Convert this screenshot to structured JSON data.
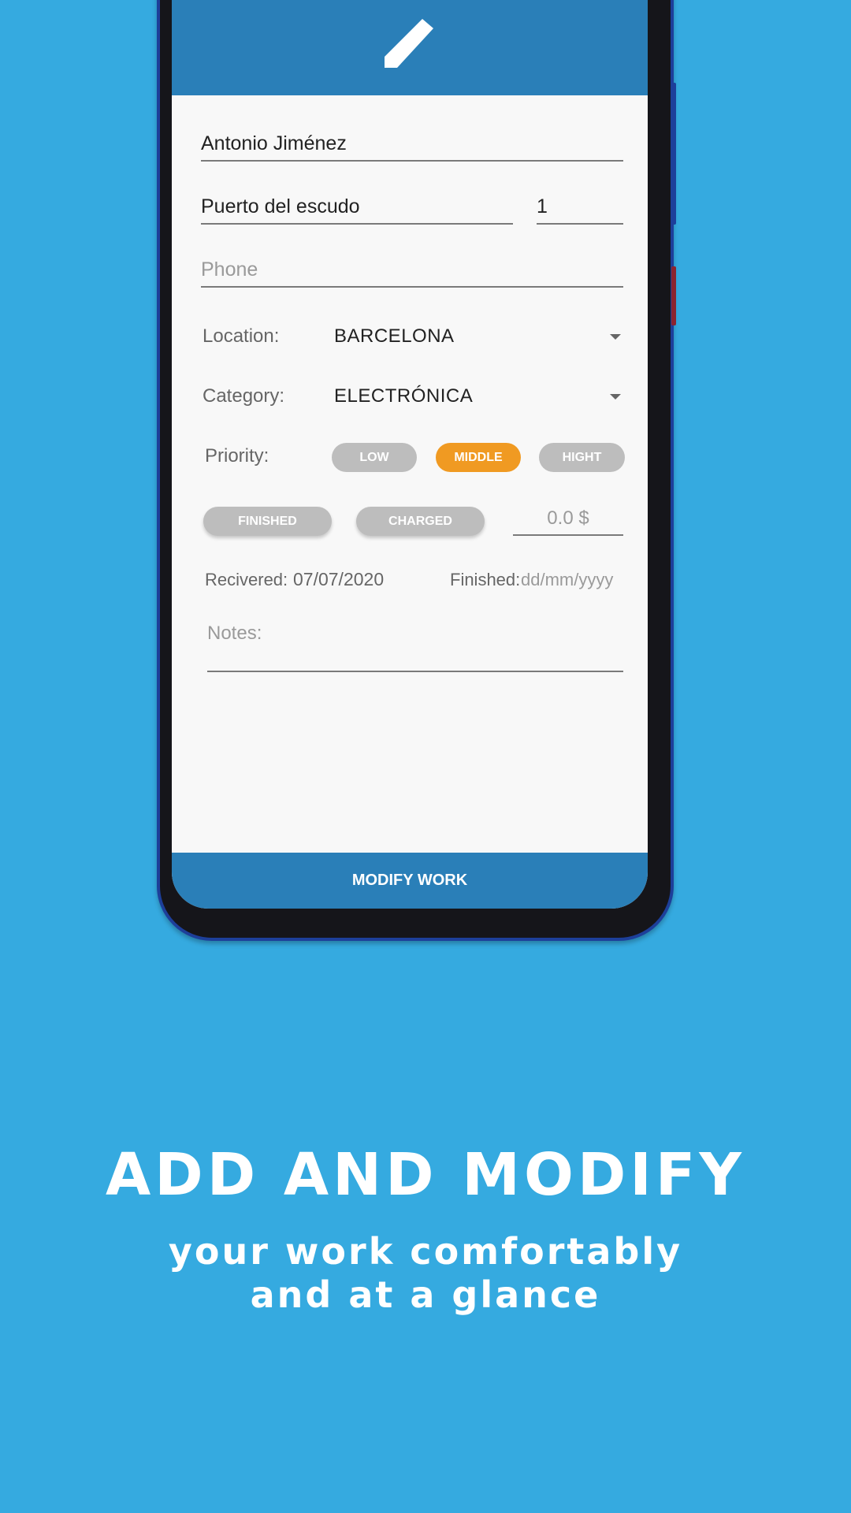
{
  "colors": {
    "background": "#35aae0",
    "primary": "#2a7fb8",
    "accent": "#f09a22",
    "chip_inactive": "#bdbdbd"
  },
  "header": {
    "icon": "pencil-icon"
  },
  "form": {
    "name": "Antonio Jiménez",
    "address": "Puerto del escudo",
    "number": "1",
    "phone_placeholder": "Phone",
    "location_label": "Location:",
    "location_value": "BARCELONA",
    "category_label": "Category:",
    "category_value": "ELECTRÓNICA",
    "priority_label": "Priority:",
    "priority_options": [
      "LOW",
      "MIDDLE",
      "HIGHT"
    ],
    "priority_selected": "MIDDLE",
    "finished_button": "FINISHED",
    "charged_button": "CHARGED",
    "price_placeholder": "0.0 $",
    "received_label": "Recivered:",
    "received_date": "07/07/2020",
    "finished_label": "Finished:",
    "finished_placeholder": "dd/mm/yyyy",
    "notes_placeholder": "Notes:"
  },
  "action": {
    "modify_label": "MODIFY WORK"
  },
  "promo": {
    "title": "ADD AND MODIFY",
    "line1": "your work comfortably",
    "line2": "and at a glance"
  }
}
